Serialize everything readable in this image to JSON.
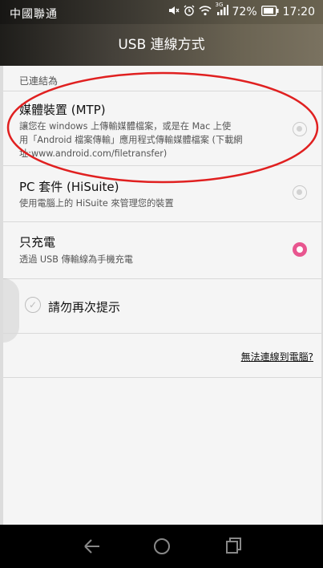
{
  "status_bar": {
    "carrier": "中國聯通",
    "network_badge": "3G",
    "battery": "72%",
    "time": "17:20"
  },
  "title": "USB 連線方式",
  "section_label": "已連結為",
  "options": [
    {
      "title": "媒體裝置 (MTP)",
      "desc_lines": [
        "讓您在 windows 上傳輸媒體檔案，或是在 Mac 上使",
        "用「Android 檔案傳輸」應用程式傳輸媒體檔案 (下載網",
        "址:www.android.com/filetransfer)"
      ],
      "selected": false
    },
    {
      "title": "PC 套件 (HiSuite)",
      "desc_lines": [
        "使用電腦上的 HiSuite 來管理您的裝置"
      ],
      "selected": false
    },
    {
      "title": "只充電",
      "desc_lines": [
        "透過 USB 傳輸線為手機充電"
      ],
      "selected": true
    }
  ],
  "dont_remind": {
    "label": "請勿再次提示",
    "checked": false
  },
  "help_link": "無法連線到電腦?",
  "colors": {
    "accent": "#e8568f",
    "highlight_ellipse": "#e02020",
    "title_bar": "#4a453b"
  },
  "icons": {
    "status": [
      "mute-icon",
      "alarm-icon",
      "wifi-icon",
      "signal-icon",
      "battery-icon"
    ],
    "nav": [
      "back-icon",
      "home-icon",
      "recents-icon"
    ]
  }
}
